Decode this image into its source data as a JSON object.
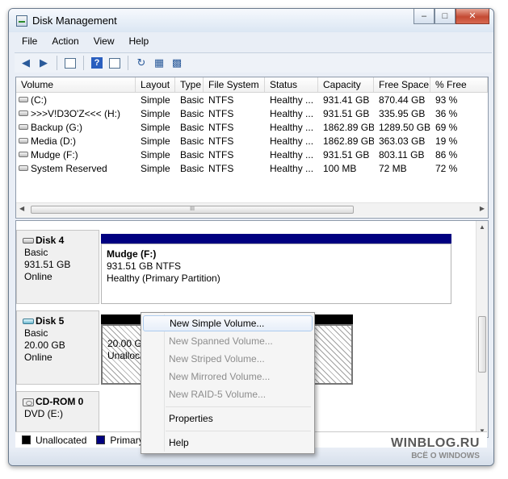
{
  "window": {
    "title": "Disk Management"
  },
  "menu": [
    "File",
    "Action",
    "View",
    "Help"
  ],
  "toolbar": {
    "icons": [
      "back-icon",
      "forward-icon",
      "console-tree-icon",
      "help-icon",
      "properties-pane-icon",
      "refresh-icon",
      "properties-icon",
      "settings-icon"
    ]
  },
  "volume_list": {
    "headers": [
      "Volume",
      "Layout",
      "Type",
      "File System",
      "Status",
      "Capacity",
      "Free Space",
      "% Free"
    ],
    "rows": [
      [
        "(C:)",
        "Simple",
        "Basic",
        "NTFS",
        "Healthy ...",
        "931.41 GB",
        "870.44 GB",
        "93 %"
      ],
      [
        ">>>V!D3O'Z<<< (H:)",
        "Simple",
        "Basic",
        "NTFS",
        "Healthy ...",
        "931.51 GB",
        "335.95 GB",
        "36 %"
      ],
      [
        "Backup  (G:)",
        "Simple",
        "Basic",
        "NTFS",
        "Healthy ...",
        "1862.89 GB",
        "1289.50 GB",
        "69 %"
      ],
      [
        "Media (D:)",
        "Simple",
        "Basic",
        "NTFS",
        "Healthy ...",
        "1862.89 GB",
        "363.03 GB",
        "19 %"
      ],
      [
        "Mudge (F:)",
        "Simple",
        "Basic",
        "NTFS",
        "Healthy ...",
        "931.51 GB",
        "803.11 GB",
        "86 %"
      ],
      [
        "System Reserved",
        "Simple",
        "Basic",
        "NTFS",
        "Healthy ...",
        "100 MB",
        "72 MB",
        "72 %"
      ]
    ],
    "scroll_thumb_label": "III"
  },
  "disks": [
    {
      "name": "Disk 4",
      "type": "Basic",
      "size": "931.51 GB",
      "state": "Online",
      "partition": {
        "name": "Mudge  (F:)",
        "size_fs": "931.51 GB NTFS",
        "status": "Healthy (Primary Partition)"
      }
    },
    {
      "name": "Disk 5",
      "type": "Basic",
      "size": "20.00 GB",
      "state": "Online",
      "partition": {
        "size": "20.00 GB",
        "status": "Unallocated"
      }
    },
    {
      "name": "CD-ROM 0",
      "drive": "DVD (E:)"
    }
  ],
  "legend": [
    {
      "label": "Unallocated",
      "color": "#000000"
    },
    {
      "label": "Primary partition",
      "color": "#000080"
    }
  ],
  "context_menu": {
    "items": [
      {
        "label": "New Simple Volume...",
        "enabled": true,
        "selected": true
      },
      {
        "label": "New Spanned Volume...",
        "enabled": false
      },
      {
        "label": "New Striped Volume...",
        "enabled": false
      },
      {
        "label": "New Mirrored Volume...",
        "enabled": false
      },
      {
        "label": "New RAID-5 Volume...",
        "enabled": false
      },
      {
        "label": "Properties",
        "enabled": true
      },
      {
        "label": "Help",
        "enabled": true
      }
    ]
  },
  "watermark": {
    "line1": "WINBLOG.RU",
    "line2": "ВСЁ О WINDOWS"
  },
  "colors": {
    "primary_partition": "#000080",
    "unallocated": "#000000",
    "close_button": "#c44a33"
  }
}
